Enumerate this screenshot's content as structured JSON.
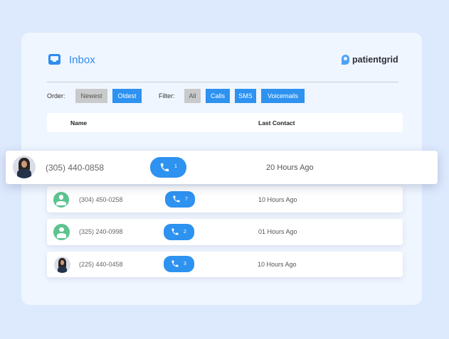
{
  "header": {
    "title": "Inbox",
    "logo_text": "patientgrid"
  },
  "controls": {
    "order_label": "Order:",
    "order_options": [
      "Newest",
      "Oldest"
    ],
    "filter_label": "Filter:",
    "filter_options": [
      "All",
      "Calls",
      "SMS",
      "Voicemails"
    ]
  },
  "table": {
    "columns": [
      "Name",
      "Last Contact"
    ],
    "rows": [
      {
        "phone": "(305) 440-0858",
        "calls": "1",
        "last_contact": "20 Hours Ago",
        "avatar": "photo"
      },
      {
        "phone": "(304) 450-0258",
        "calls": "7",
        "last_contact": "10 Hours Ago",
        "avatar": "generic"
      },
      {
        "phone": "(325) 240-0998",
        "calls": "2",
        "last_contact": "01 Hours Ago",
        "avatar": "generic"
      },
      {
        "phone": "(225) 440-0458",
        "calls": "3",
        "last_contact": "10 Hours Ago",
        "avatar": "photo"
      }
    ]
  },
  "colors": {
    "accent": "#2e92f0",
    "avatar_green": "#5cc38f",
    "background": "#dde9fd"
  },
  "icons": [
    "inbox-icon",
    "phone-icon",
    "user-icon"
  ]
}
